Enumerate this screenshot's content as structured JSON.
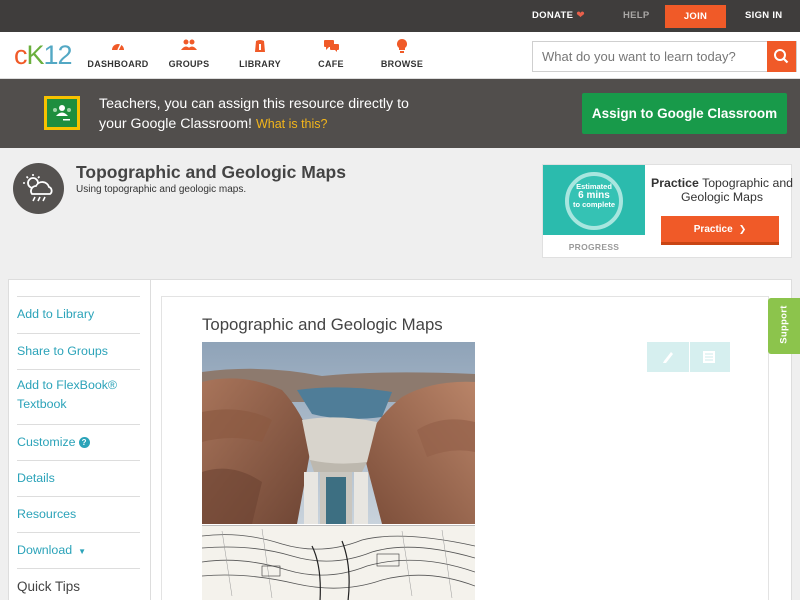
{
  "topbar": {
    "donate": "DONATE",
    "help": "HELP",
    "join": "JOIN",
    "signin": "SIGN IN"
  },
  "header": {
    "logo": {
      "c": "c",
      "k": "K",
      "n": "12"
    },
    "nav": [
      {
        "label": "DASHBOARD",
        "icon": "dashboard-icon"
      },
      {
        "label": "GROUPS",
        "icon": "groups-icon"
      },
      {
        "label": "LIBRARY",
        "icon": "library-icon"
      },
      {
        "label": "CAFE",
        "icon": "cafe-icon"
      },
      {
        "label": "BROWSE",
        "icon": "browse-icon"
      }
    ],
    "search": {
      "placeholder": "What do you want to learn today?",
      "value": ""
    }
  },
  "classroom_banner": {
    "line1": "Teachers, you can assign this resource directly to",
    "line2": "your Google Classroom!",
    "what": "What is this?",
    "button": "Assign to Google Classroom"
  },
  "concept": {
    "title": "Topographic and Geologic Maps",
    "subtitle": "Using topographic and geologic maps."
  },
  "practice": {
    "ring_line1": "Estimated",
    "ring_line2": "6 mins",
    "ring_line3": "to complete",
    "progress_label": "PROGRESS",
    "heading_bold": "Practice",
    "heading_rest": "Topographic and Geologic Maps",
    "button": "Practice"
  },
  "sidebar": {
    "items": [
      {
        "label": "Add to Library"
      },
      {
        "label": "Share to Groups"
      },
      {
        "label": "Add to FlexBook® Textbook"
      },
      {
        "label": "Customize"
      },
      {
        "label": "Details"
      },
      {
        "label": "Resources"
      },
      {
        "label": "Download"
      }
    ],
    "quick_tips": "Quick Tips"
  },
  "content": {
    "title": "Topographic and Geologic Maps"
  },
  "support": "Support",
  "colors": {
    "accent": "#f05a28",
    "teal": "#2ba3b9",
    "green": "#189a4a",
    "support_green": "#8cc44c",
    "banner": "#514e4c",
    "topbar": "#3f3d3c"
  }
}
